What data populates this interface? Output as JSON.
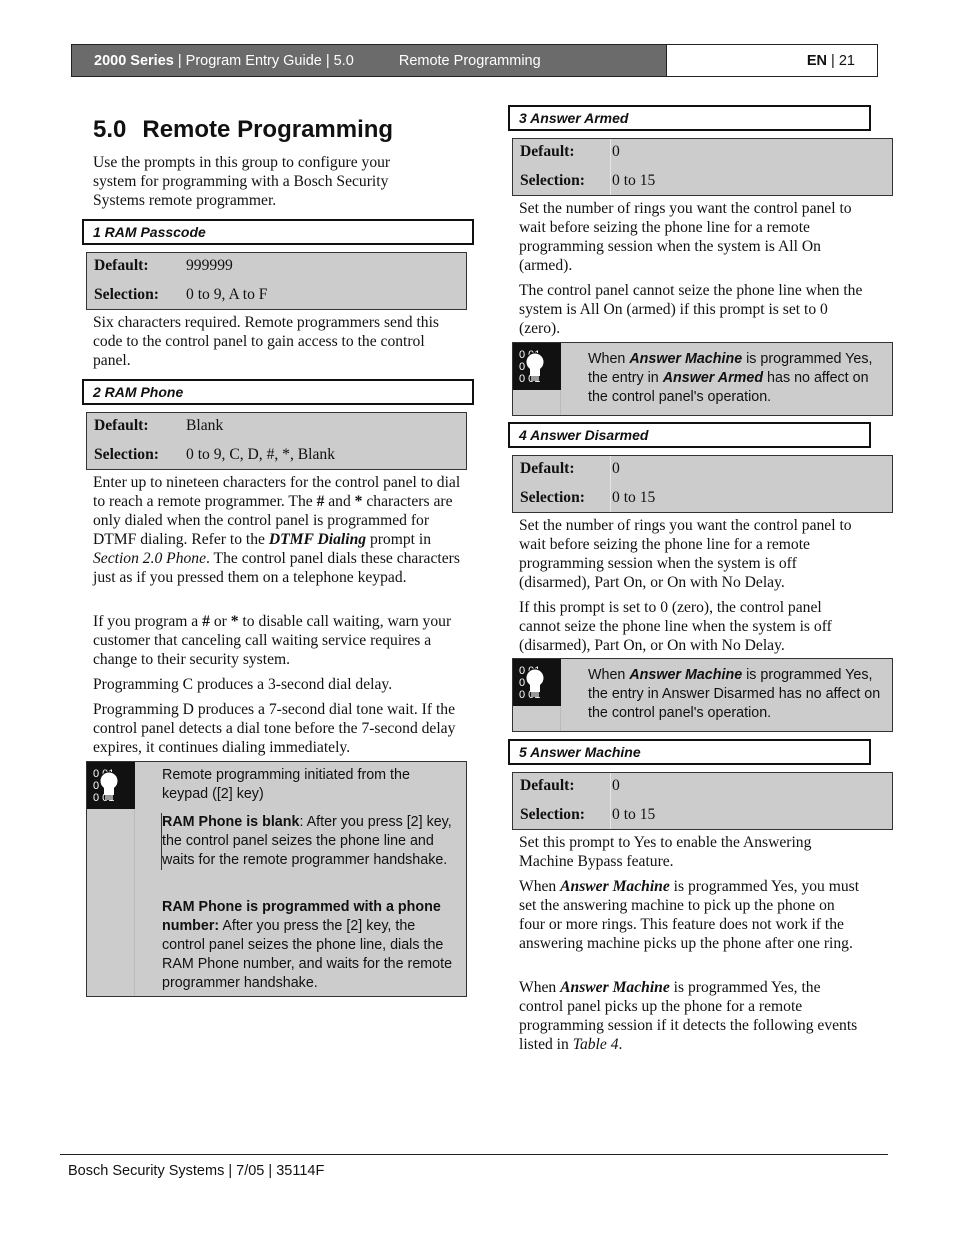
{
  "header": {
    "series": "2000 Series",
    "guide": "Program Entry Guide | 5.0",
    "section": "Remote Programming",
    "lang": "EN",
    "page": "21"
  },
  "title": {
    "number": "5.0",
    "text": "Remote Programming"
  },
  "intro": "Use the prompts in this group to configure your system for programming with a Bosch Security Systems remote programmer.",
  "prompts": [
    {
      "title": "1 RAM Passcode",
      "default_label": "Default:",
      "default": "999999",
      "selection_label": "Selection:",
      "selection": "0 to 9, A to F",
      "paragraphs": [
        "Six characters required. Remote programmers send this code to the control panel to gain access to the control panel."
      ]
    },
    {
      "title": "2 RAM Phone",
      "default_label": "Default:",
      "default": "Blank",
      "selection_label": "Selection:",
      "selection": "0 to 9, C, D, #, *, Blank",
      "paragraphs": [
        "Enter up to nineteen characters for the control panel to dial to reach a remote programmer. The # and * characters are only dialed when the control panel is programmed for DTMF dialing. Refer to the DTMF Dialing prompt in Section 2.0 Phone. The control panel dials these characters just as if you pressed them on a telephone keypad.",
        "If you program a # or * to disable call waiting, warn your customer that canceling call waiting service requires a change to their security system.",
        "Programming C produces a 3-second dial delay.",
        "Programming D produces a 7-second dial tone wait. If the control panel detects a dial tone before the 7-second delay expires, it continues dialing immediately."
      ],
      "p1_parts": {
        "a": "Enter up to nineteen characters for the control panel to dial to reach a remote programmer. The ",
        "hash": "#",
        "b": " and ",
        "star": "*",
        "c": " characters are only dialed when the control panel is programmed for DTMF dialing. Refer to the ",
        "ref_prompt": "DTMF Dialing",
        "d": " prompt in ",
        "ref_section": "Section 2.0 Phone",
        "e": ". The control panel dials these characters just as if you pressed them on a telephone keypad."
      },
      "p2_parts": {
        "a": "If you program a ",
        "hash": "#",
        "b": " or ",
        "star": "*",
        "c": " to disable call waiting, warn your customer that canceling call waiting service requires a change to their security system."
      },
      "note": {
        "icon": "lightbulb-icon",
        "intro": "Remote programming initiated from the keypad ([2] key)",
        "item1_bold": "RAM Phone is blank",
        "item1_text": ": After you press [2] key, the control panel seizes the phone line and waits for the remote programmer handshake.",
        "item2_bold": "RAM Phone is programmed with a phone number:",
        "item2_text": " After you press the [2] key, the control panel seizes the phone line, dials the RAM Phone number, and waits for the remote programmer handshake."
      }
    },
    {
      "title": "3 Answer Armed",
      "default_label": "Default:",
      "default": "0",
      "selection_label": "Selection:",
      "selection": "0 to 15",
      "paragraphs": [
        "Set the number of rings you want the control panel to wait before seizing the phone line for a remote programming session when the system is All On (armed).",
        "The control panel cannot seize the phone line when the system is All On (armed) if this prompt is set to 0 (zero)."
      ],
      "note": {
        "icon": "lightbulb-icon",
        "a": "When ",
        "b1": "Answer Machine",
        "c": " is programmed Yes, the entry in ",
        "b2": "Answer Armed",
        "d": " has no affect on the control panel's operation."
      }
    },
    {
      "title": "4 Answer Disarmed",
      "default_label": "Default:",
      "default": "0",
      "selection_label": "Selection:",
      "selection": "0 to 15",
      "paragraphs": [
        "Set the number of rings you want the control panel to wait before seizing the phone line for a remote programming session when the system is off (disarmed), Part On, or On with No Delay.",
        "If this prompt is set to 0 (zero), the control panel cannot seize the phone line when the system is off (disarmed), Part On, or On with No Delay."
      ],
      "note": {
        "icon": "lightbulb-icon",
        "a": "When ",
        "b1": "Answer Machine",
        "c": " is programmed Yes, the entry in Answer Disarmed has no affect on the control panel's operation."
      }
    },
    {
      "title": "5 Answer Machine",
      "default_label": "Default:",
      "default": "0",
      "selection_label": "Selection:",
      "selection": "0 to 15",
      "paragraphs": [
        "Set this prompt to Yes to enable the Answering Machine Bypass feature."
      ],
      "p2_parts": {
        "a": "When ",
        "b": "Answer Machine",
        "c": " is programmed Yes, you must set the answering machine to pick up the phone on four or more rings. This feature does not work if the answering machine picks up the phone after one ring."
      },
      "p3_parts": {
        "a": "When ",
        "b": "Answer Machine",
        "c": " is programmed Yes, the control panel picks up the phone for a remote programming session if it detects the following events listed in ",
        "ref": "Table 4",
        "d": "."
      }
    }
  ],
  "footer": {
    "text": "Bosch Security Systems | 7/05 | 35114F"
  }
}
